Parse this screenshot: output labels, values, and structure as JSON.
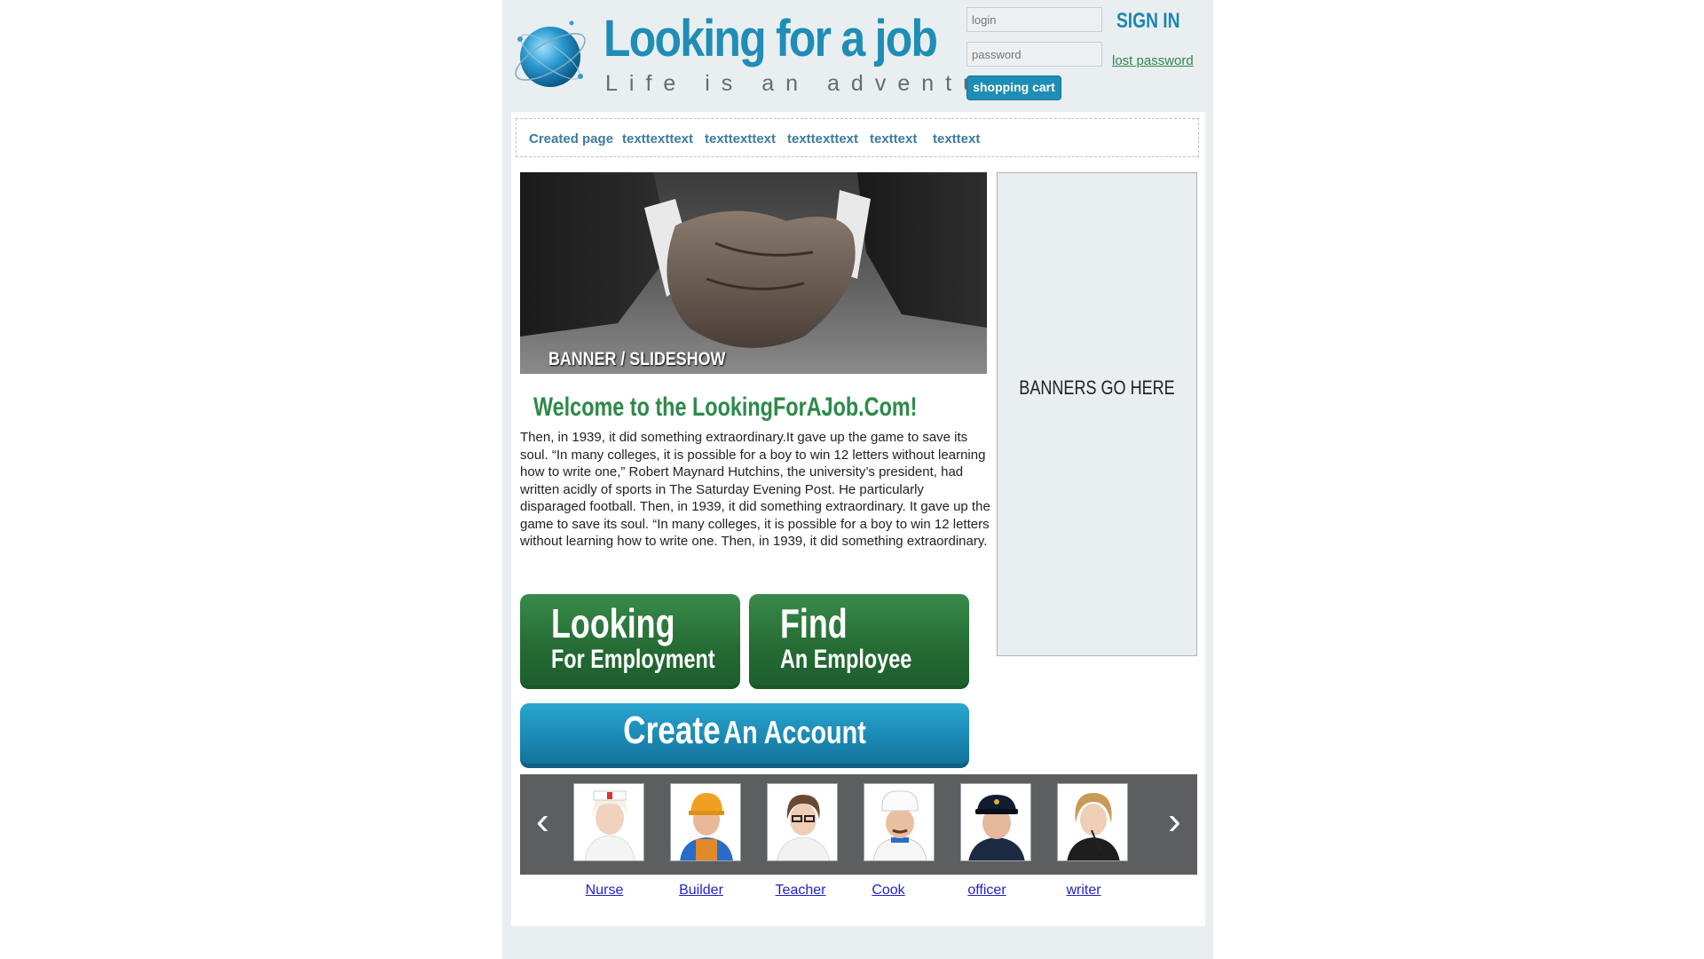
{
  "logo": {
    "title": "Looking for a job",
    "tagline": "Life is an adventure",
    "globe_icon": "globe-icon"
  },
  "header": {
    "login_placeholder": "login",
    "password_placeholder": "password",
    "sign_in": "SIGN IN",
    "lost_password": "lost password",
    "shopping_cart": "shopping cart"
  },
  "nav": {
    "items": [
      "Created page",
      "texttexttext",
      "texttexttext",
      "texttexttext",
      "texttext",
      "texttext"
    ]
  },
  "banner": {
    "label": "BANNER / SLIDESHOW"
  },
  "side_banner": {
    "text": "BANNERS GO HERE"
  },
  "welcome": {
    "title": "Welcome to the LookingForAJob.Com!",
    "body": " Then, in 1939, it did something extraordinary.It gave up the game to save its soul. “In many colleges, it is possible for a boy to win 12 letters without learning how to write one,” Robert Maynard Hutchins, the university’s president, had written acidly of sports in The Saturday Evening Post. He particularly disparaged football. Then, in 1939, it did something extraordinary. It gave up the game to save its soul. “In many colleges, it is possible for a boy to win 12 letters without learning how to write one. Then, in 1939, it did something extraordinary."
  },
  "buttons": {
    "employment_big": "Looking",
    "employment_small": "For Employment",
    "employee_big": "Find",
    "employee_small": "An Employee",
    "create_big": "Create",
    "create_small": "An Account"
  },
  "carousel": {
    "prev": "‹",
    "next": "›",
    "jobs": [
      {
        "label": "Nurse",
        "icon": "nurse-photo"
      },
      {
        "label": "Builder",
        "icon": "builder-photo"
      },
      {
        "label": "Teacher",
        "icon": "teacher-photo"
      },
      {
        "label": "Cook",
        "icon": "cook-photo"
      },
      {
        "label": "officer",
        "icon": "officer-photo"
      },
      {
        "label": "writer",
        "icon": "writer-photo"
      }
    ]
  },
  "colors": {
    "brand_blue": "#1f8db5",
    "brand_green": "#2c8a48",
    "page_bg": "#e9eef0"
  }
}
